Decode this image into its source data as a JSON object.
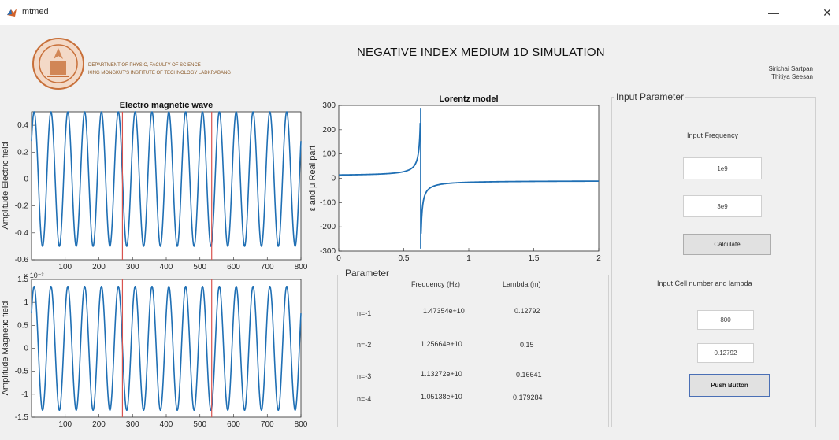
{
  "window": {
    "title": "mtmed",
    "minimize": "—",
    "close": "✕"
  },
  "header": {
    "title": "NEGATIVE INDEX MEDIUM 1D SIMULATION",
    "authors": [
      "Sirichai Sartpan",
      "Thitiya Seesan"
    ],
    "dept_line1": "DEPARTMENT OF PHYSIC, FACULTY OF SCIENCE",
    "dept_line2": "KING MONGKUT'S INSTITUTE OF TECHNOLOGY LADKRABANG"
  },
  "input_panel": {
    "title": "Input Parameter",
    "freq_label": "Input Frequency",
    "freq1": "1e9",
    "freq2": "3e9",
    "calculate_label": "Calculate",
    "cell_label": "Input Cell number and lambda",
    "cell_number": "800",
    "lambda": "0.12792",
    "push_label": "Push Button"
  },
  "parameter_panel": {
    "title": "Parameter",
    "headers": [
      "Frequency (Hz)",
      "Lambda (m)"
    ],
    "rows": [
      {
        "n": "n=-1",
        "freq": "1.47354e+10",
        "lambda": "0.12792"
      },
      {
        "n": "n=-2",
        "freq": "1.25664e+10",
        "lambda": "0.15"
      },
      {
        "n": "n=-3",
        "freq": "1.13272e+10",
        "lambda": "0.16641"
      },
      {
        "n": "n=-4",
        "freq": "1.05138e+10",
        "lambda": "0.179284"
      }
    ]
  },
  "chart_data": [
    {
      "type": "line",
      "title": "Electro magnetic wave",
      "xlabel": "",
      "ylabel": "Amplitude Electric field",
      "xlim": [
        0,
        800
      ],
      "ylim": [
        -0.6,
        0.5
      ],
      "xticks": [
        "100",
        "200",
        "300",
        "400",
        "500",
        "600",
        "700",
        "800"
      ],
      "yticks": [
        "0.4",
        "0.2",
        "0",
        "-0.2",
        "-0.4",
        "-0.6"
      ],
      "amplitude": 0.5,
      "cycles": 16,
      "markers_x": [
        270,
        535
      ],
      "color": "#1f6fb4",
      "marker_color": "#d9534f"
    },
    {
      "type": "line",
      "title": "",
      "xlabel": "",
      "ylabel": "Amplitude Magnetic field",
      "exponent_label": "× 10⁻³",
      "xlim": [
        0,
        800
      ],
      "ylim": [
        -1.5,
        1.5
      ],
      "xticks": [
        "100",
        "200",
        "300",
        "400",
        "500",
        "600",
        "700",
        "800"
      ],
      "yticks": [
        "1.5",
        "1",
        "0.5",
        "0",
        "-0.5",
        "-1",
        "-1.5"
      ],
      "amplitude": 1.35,
      "cycles": 16,
      "markers_x": [
        270,
        535
      ],
      "color": "#1f6fb4",
      "marker_color": "#d9534f"
    },
    {
      "type": "line",
      "title": "Lorentz model",
      "xlabel": "",
      "ylabel": "ε and μ Real part",
      "xlim": [
        0,
        2
      ],
      "ylim": [
        -300,
        300
      ],
      "xticks": [
        "0",
        "0.5",
        "1",
        "1.5",
        "2"
      ],
      "yticks": [
        "300",
        "200",
        "100",
        "0",
        "-100",
        "-200",
        "-300"
      ],
      "resonance_x": 0.63,
      "color": "#1f6fb4"
    }
  ]
}
